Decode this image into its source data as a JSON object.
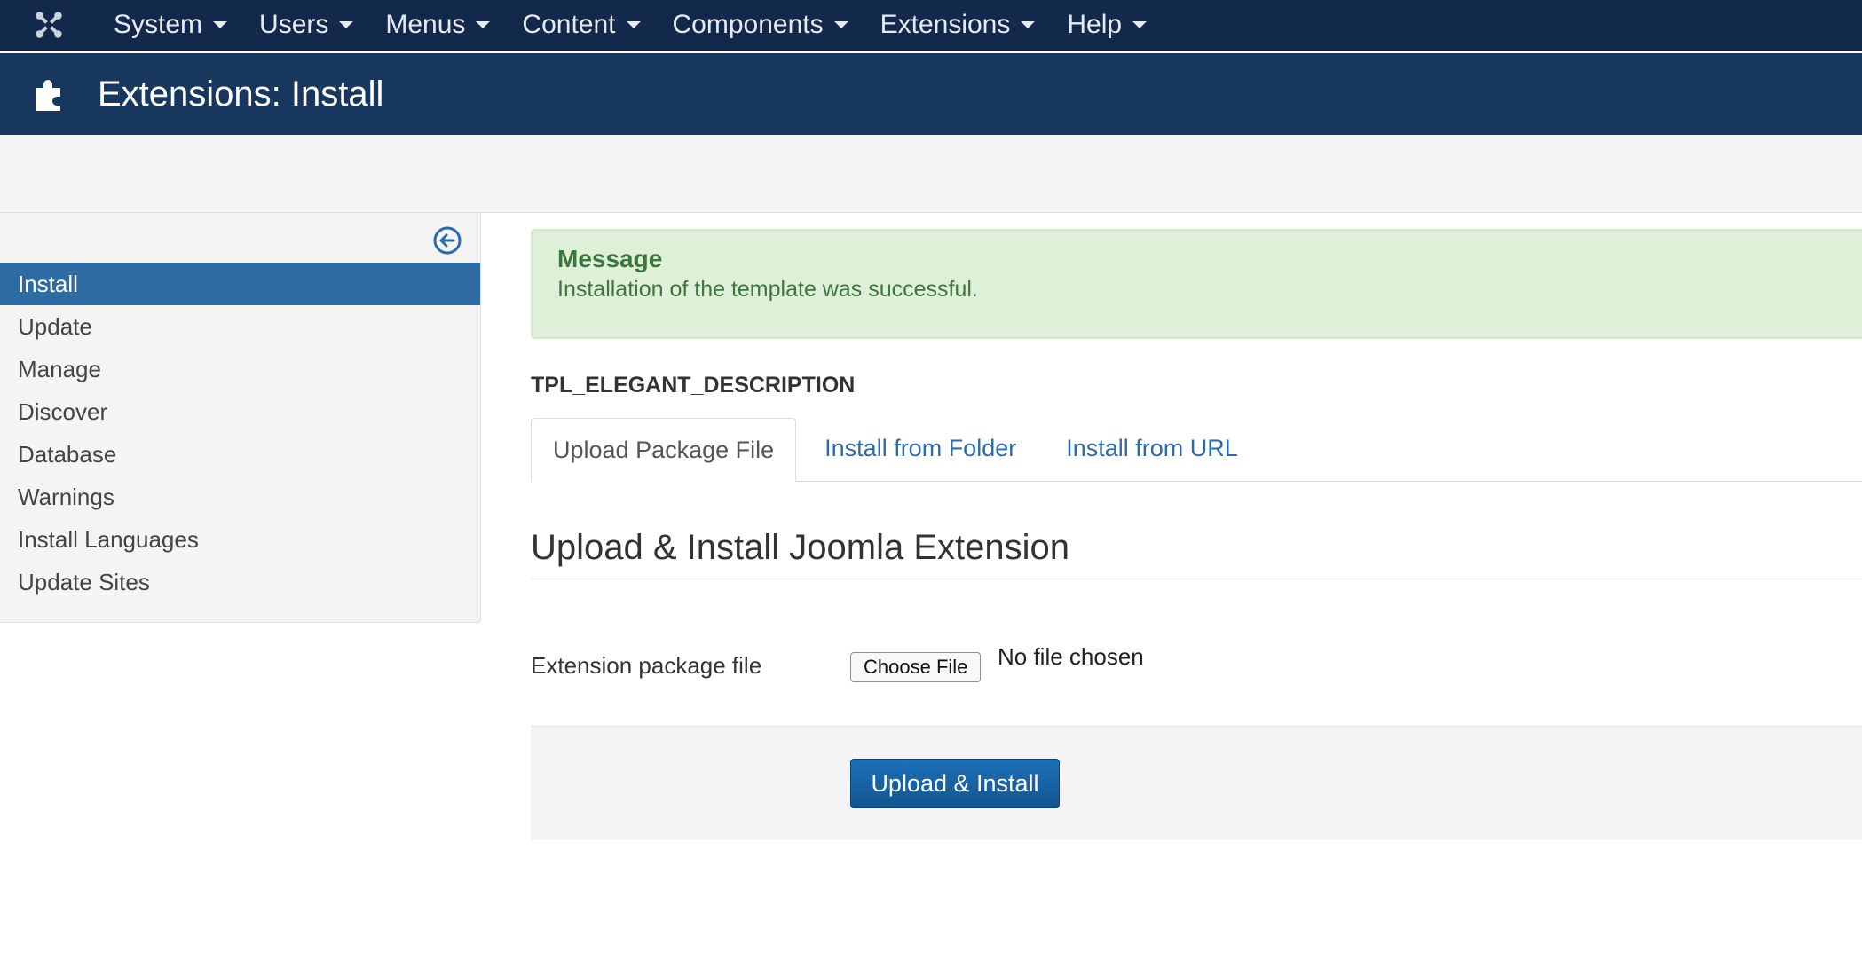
{
  "navbar": {
    "logo_icon": "joomla-logo-icon",
    "menus": [
      {
        "label": "System"
      },
      {
        "label": "Users"
      },
      {
        "label": "Menus"
      },
      {
        "label": "Content"
      },
      {
        "label": "Components"
      },
      {
        "label": "Extensions"
      },
      {
        "label": "Help"
      }
    ]
  },
  "header": {
    "icon": "puzzle-icon",
    "title": "Extensions: Install"
  },
  "sidebar": {
    "toggle_icon": "arrow-circle-left-icon",
    "items": [
      {
        "label": "Install",
        "active": true
      },
      {
        "label": "Update"
      },
      {
        "label": "Manage"
      },
      {
        "label": "Discover"
      },
      {
        "label": "Database"
      },
      {
        "label": "Warnings"
      },
      {
        "label": "Install Languages"
      },
      {
        "label": "Update Sites"
      }
    ]
  },
  "alert": {
    "heading": "Message",
    "text": "Installation of the template was successful."
  },
  "description": "TPL_ELEGANT_DESCRIPTION",
  "tabs": [
    {
      "label": "Upload Package File",
      "active": true
    },
    {
      "label": "Install from Folder"
    },
    {
      "label": "Install from URL"
    }
  ],
  "form": {
    "legend": "Upload & Install Joomla Extension",
    "field_label": "Extension package file",
    "file_button": "Choose File",
    "file_status": "No file chosen",
    "submit_label": "Upload & Install"
  },
  "colors": {
    "navbar_bg": "#13294b",
    "header_bg": "#17375e",
    "active_item": "#2d6ca2",
    "success_bg": "#dff0d8",
    "success_text": "#3c763d",
    "link": "#2a6aad"
  }
}
